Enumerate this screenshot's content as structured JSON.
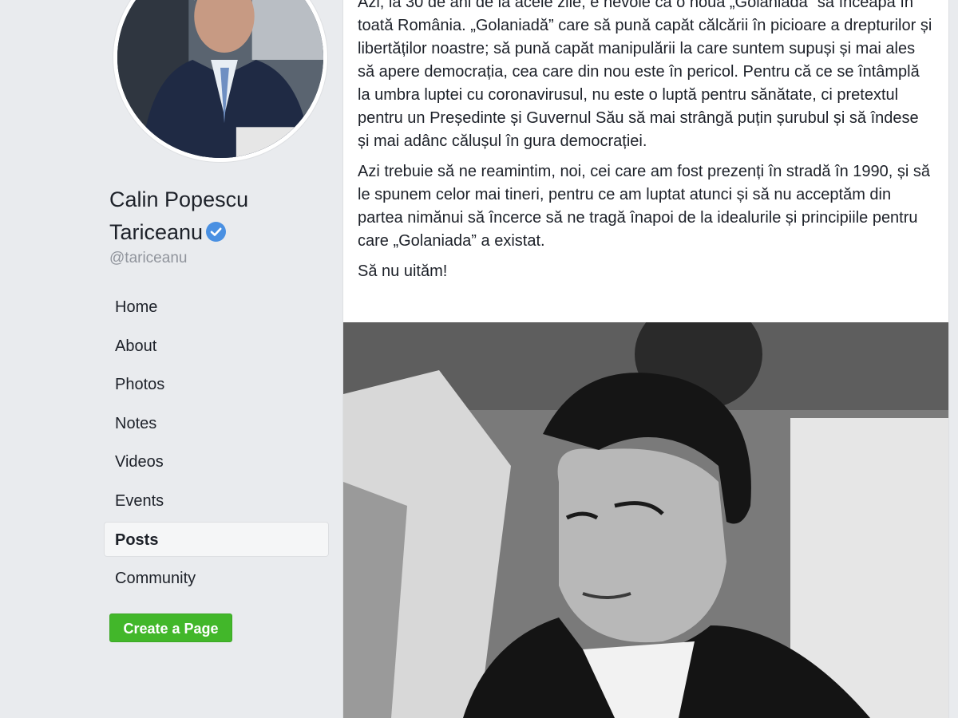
{
  "page": {
    "name": "Calin Popescu Tariceanu",
    "handle": "@tariceanu",
    "verified": true
  },
  "nav": {
    "items": [
      {
        "label": "Home",
        "active": false
      },
      {
        "label": "About",
        "active": false
      },
      {
        "label": "Photos",
        "active": false
      },
      {
        "label": "Notes",
        "active": false
      },
      {
        "label": "Videos",
        "active": false
      },
      {
        "label": "Events",
        "active": false
      },
      {
        "label": "Posts",
        "active": true
      },
      {
        "label": "Community",
        "active": false
      }
    ],
    "create_page_label": "Create a Page"
  },
  "post": {
    "paragraphs": [
      "Azi, la 30 de ani de la acele zile, e nevoie ca o nouă „Golaniadă” să înceapă în toată România. „Golaniadă” care să pună capăt călcării în picioare a drepturilor și libertăților noastre; să pună capăt manipulării la care suntem supuși și mai ales să apere democrația, cea care din nou este în pericol. Pentru că ce se întâmplă la umbra luptei cu coronavirusul, nu este o luptă pentru sănătate, ci pretextul pentru un Președinte și Guvernul Său să mai strângă puțin șurubul și să îndese și mai adânc călușul în gura democrației.",
      "Azi trebuie să ne reamintim, noi, cei care am fost prezenți în stradă în 1990, și să le spunem celor mai tineri, pentru ce am luptat atunci și să nu acceptăm din partea nimănui să încerce să ne tragă înapoi de la idealurile și principiile pentru care „Golaniada” a existat.",
      "Să nu uităm!"
    ]
  },
  "colors": {
    "background": "#e9ebee",
    "verified_badge": "#4a90e2",
    "create_button": "#42b72a",
    "handle_text": "#90949c"
  },
  "icons": {
    "verified": "verified-check-icon"
  }
}
